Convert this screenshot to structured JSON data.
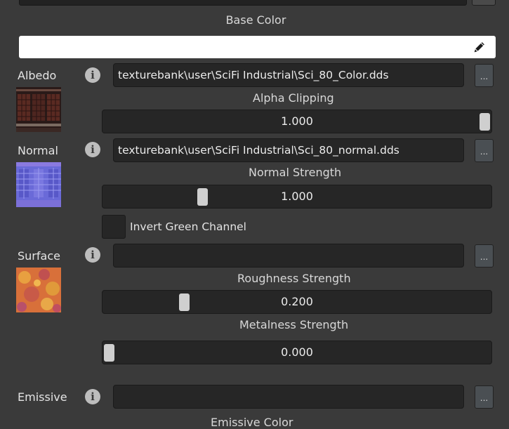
{
  "base_color": {
    "title": "Base Color",
    "value": "#ffffff"
  },
  "albedo": {
    "label": "Albedo",
    "path": "texturebank\\user\\SciFi Industrial\\Sci_80_Color.dds",
    "browse": "...",
    "alpha_clipping": {
      "label": "Alpha Clipping",
      "value": "1.000",
      "fraction": 1.0
    }
  },
  "normal": {
    "label": "Normal",
    "path": "texturebank\\user\\SciFi Industrial\\Sci_80_normal.dds",
    "browse": "...",
    "strength": {
      "label": "Normal Strength",
      "value": "1.000",
      "fraction": 0.25
    },
    "invert_green": {
      "label": "Invert Green Channel",
      "checked": false
    }
  },
  "surface": {
    "label": "Surface",
    "path": "",
    "browse": "...",
    "roughness": {
      "label": "Roughness Strength",
      "value": "0.200",
      "fraction": 0.2
    },
    "metalness": {
      "label": "Metalness Strength",
      "value": "0.000",
      "fraction": 0.0
    }
  },
  "emissive": {
    "label": "Emissive",
    "path": "",
    "browse": "...",
    "color_title": "Emissive Color"
  },
  "icons": [
    "info-icon",
    "pencil-icon",
    "ellipsis-icon"
  ]
}
